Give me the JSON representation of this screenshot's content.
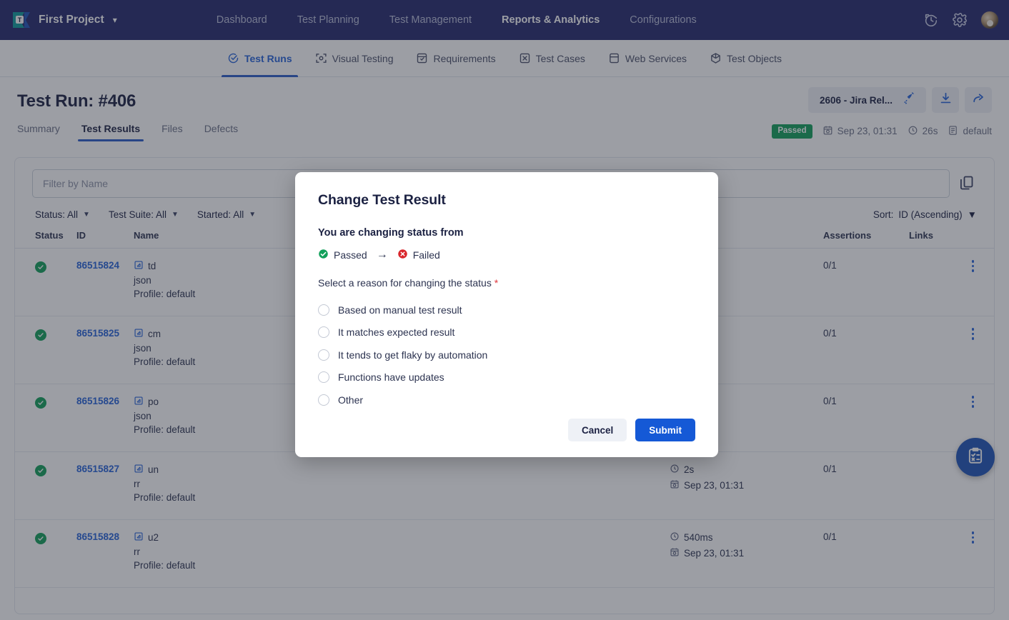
{
  "topnav": {
    "brand": "First Project",
    "brand_caret": "chevron-down",
    "menu": [
      {
        "label": "Dashboard",
        "active": false
      },
      {
        "label": "Test Planning",
        "active": false
      },
      {
        "label": "Test Management",
        "active": false
      },
      {
        "label": "Reports & Analytics",
        "active": true
      },
      {
        "label": "Configurations",
        "active": false
      }
    ],
    "icons": [
      "history-icon",
      "gear-icon",
      "avatar"
    ],
    "bg_color": "#23276b"
  },
  "subtabs": [
    {
      "label": "Test Runs",
      "icon": "test-runs-icon",
      "active": true
    },
    {
      "label": "Visual Testing",
      "icon": "visual-testing-icon",
      "active": false
    },
    {
      "label": "Requirements",
      "icon": "requirements-icon",
      "active": false
    },
    {
      "label": "Test Cases",
      "icon": "test-cases-icon",
      "active": false
    },
    {
      "label": "Web Services",
      "icon": "web-services-icon",
      "active": false
    },
    {
      "label": "Test Objects",
      "icon": "test-objects-icon",
      "active": false
    }
  ],
  "page": {
    "title": "Test Run: #406",
    "tabs": [
      {
        "label": "Summary",
        "active": false
      },
      {
        "label": "Test Results",
        "active": true
      },
      {
        "label": "Files",
        "active": false
      },
      {
        "label": "Defects",
        "active": false
      }
    ],
    "release_chip": "2606 - Jira Rel...",
    "release_chip_icon": "rocket-icon",
    "download_icon": "download-icon",
    "share_icon": "share-icon",
    "status_badge": "Passed",
    "status_badge_color": "#12a05a",
    "meta_date": "Sep 23, 01:31",
    "meta_duration": "26s",
    "meta_profile": "default"
  },
  "toolbar": {
    "filter_placeholder": "Filter by Name",
    "filter_value": "",
    "copy_icon": "copy-icon",
    "filters": [
      {
        "label": "Status: All"
      },
      {
        "label": "Test Suite: All"
      },
      {
        "label": "Started: All"
      }
    ],
    "sort_label": "Sort:",
    "sort_value": "ID (Ascending)"
  },
  "table": {
    "columns": [
      "Status",
      "ID",
      "Name",
      "",
      "Assertions",
      "Links"
    ],
    "rows": [
      {
        "status": "passed",
        "id": "86515824",
        "name": "td",
        "sub": "json",
        "profile": "Profile: default",
        "duration": "",
        "date": "",
        "assertions": "0/1"
      },
      {
        "status": "passed",
        "id": "86515825",
        "name": "cm",
        "sub": "json",
        "profile": "Profile: default",
        "duration": "",
        "date": "",
        "assertions": "0/1"
      },
      {
        "status": "passed",
        "id": "86515826",
        "name": "po",
        "sub": "json",
        "profile": "Profile: default",
        "duration": "",
        "date": "",
        "assertions": "0/1"
      },
      {
        "status": "passed",
        "id": "86515827",
        "name": "un",
        "sub": "rr",
        "profile": "Profile: default",
        "duration": "2s",
        "date": "Sep 23, 01:31",
        "assertions": "0/1"
      },
      {
        "status": "passed",
        "id": "86515828",
        "name": "u2",
        "sub": "rr",
        "profile": "Profile: default",
        "duration": "540ms",
        "date": "Sep 23, 01:31",
        "assertions": "0/1"
      }
    ]
  },
  "fab": {
    "icon": "clipboard-check-icon"
  },
  "modal": {
    "title": "Change Test Result",
    "subtitle": "You are changing status from",
    "from_status": "Passed",
    "to_status": "Failed",
    "from_color": "#12a05a",
    "to_color": "#d9262c",
    "arrow": "→",
    "reason_label": "Select a reason for changing the status",
    "required_mark": "*",
    "options": [
      {
        "label": "Based on manual test result",
        "selected": false
      },
      {
        "label": "It matches expected result",
        "selected": false
      },
      {
        "label": "It tends to get flaky by automation",
        "selected": false
      },
      {
        "label": "Functions have updates",
        "selected": false
      },
      {
        "label": "Other",
        "selected": false
      }
    ],
    "cancel_label": "Cancel",
    "submit_label": "Submit",
    "submit_color": "#1559d6"
  }
}
